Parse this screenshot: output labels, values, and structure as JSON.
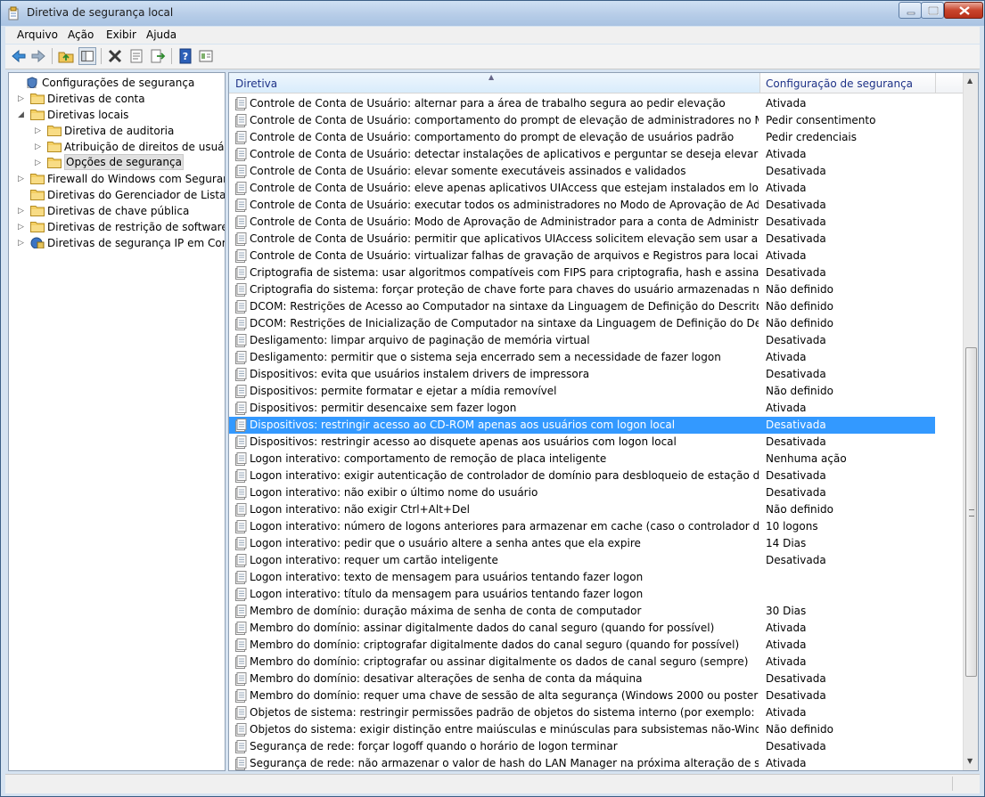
{
  "window": {
    "title": "Diretiva de segurança local"
  },
  "menu": [
    "Arquivo",
    "Ação",
    "Exibir",
    "Ajuda"
  ],
  "toolbar": [
    "back-icon",
    "forward-icon",
    "up-folder-icon",
    "show-hide-tree-icon",
    "delete-icon",
    "properties-icon",
    "export-list-icon",
    "help-icon",
    "view-icon"
  ],
  "tree": [
    {
      "label": "Configurações de segurança",
      "level": 0,
      "expander": "",
      "icon": "shield-icon",
      "selected": false
    },
    {
      "label": "Diretivas de conta",
      "level": 1,
      "expander": "▷",
      "icon": "folder-icon",
      "selected": false
    },
    {
      "label": "Diretivas locais",
      "level": 1,
      "expander": "◢",
      "icon": "folder-icon",
      "selected": false
    },
    {
      "label": "Diretiva de auditoria",
      "level": 2,
      "expander": "▷",
      "icon": "folder-icon",
      "selected": false
    },
    {
      "label": "Atribuição de direitos de usuário",
      "level": 2,
      "expander": "▷",
      "icon": "folder-icon",
      "selected": false
    },
    {
      "label": "Opções de segurança",
      "level": 2,
      "expander": "▷",
      "icon": "folder-icon",
      "selected": true
    },
    {
      "label": "Firewall do Windows com Segurança",
      "level": 1,
      "expander": "▷",
      "icon": "folder-icon",
      "selected": false
    },
    {
      "label": "Diretivas do Gerenciador de Listas de",
      "level": 1,
      "expander": "",
      "icon": "folder-icon",
      "selected": false
    },
    {
      "label": "Diretivas de chave pública",
      "level": 1,
      "expander": "▷",
      "icon": "folder-icon",
      "selected": false
    },
    {
      "label": "Diretivas de restrição de software",
      "level": 1,
      "expander": "▷",
      "icon": "folder-icon",
      "selected": false
    },
    {
      "label": "Diretivas de segurança IP em Comput",
      "level": 1,
      "expander": "▷",
      "icon": "network-policy-icon",
      "selected": false
    }
  ],
  "list": {
    "columns": [
      "Diretiva",
      "Configuração de segurança"
    ],
    "selected_index": 19,
    "rows": [
      {
        "policy": "Controle de Conta de Usuário: alternar para a área de trabalho segura ao pedir elevação",
        "setting": "Ativada"
      },
      {
        "policy": "Controle de Conta de Usuário: comportamento do prompt de elevação de administradores no Modo de A...",
        "setting": "Pedir consentimento"
      },
      {
        "policy": "Controle de Conta de Usuário: comportamento do prompt de elevação de usuários padrão",
        "setting": "Pedir credenciais"
      },
      {
        "policy": "Controle de Conta de Usuário: detectar instalações de aplicativos e perguntar se deseja elevar",
        "setting": "Ativada"
      },
      {
        "policy": "Controle de Conta de Usuário: elevar somente executáveis assinados e validados",
        "setting": "Desativada"
      },
      {
        "policy": "Controle de Conta de Usuário: eleve apenas aplicativos UIAccess que estejam instalados em locais seguros",
        "setting": "Ativada"
      },
      {
        "policy": "Controle de Conta de Usuário: executar todos os administradores no Modo de Aprovação de Administrador",
        "setting": "Desativada"
      },
      {
        "policy": "Controle de Conta de Usuário: Modo de Aprovação de Administrador para a conta de Administrador Interno",
        "setting": "Desativada"
      },
      {
        "policy": "Controle de Conta de Usuário: permitir que aplicativos UIAccess solicitem elevação sem usar a área de trab...",
        "setting": "Desativada"
      },
      {
        "policy": "Controle de Conta de Usuário: virtualizar falhas de gravação de arquivos e Registros para locais por usuário",
        "setting": "Ativada"
      },
      {
        "policy": "Criptografia de sistema: usar algoritmos compatíveis com FIPS para criptografia, hash e assinatura",
        "setting": "Desativada"
      },
      {
        "policy": "Criptografia do sistema: forçar proteção de chave forte para chaves do usuário armazenadas no computador",
        "setting": "Não definido"
      },
      {
        "policy": "DCOM: Restrições de Acesso ao Computador na sintaxe da Linguagem de Definição do Descritor de Segur...",
        "setting": "Não definido"
      },
      {
        "policy": "DCOM: Restrições de Inicialização de Computador na sintaxe da Linguagem de Definição do Descritor de S...",
        "setting": "Não definido"
      },
      {
        "policy": "Desligamento: limpar arquivo de paginação de memória virtual",
        "setting": "Desativada"
      },
      {
        "policy": "Desligamento: permitir que o sistema seja encerrado sem a necessidade de fazer logon",
        "setting": "Ativada"
      },
      {
        "policy": "Dispositivos: evita que usuários instalem drivers de impressora",
        "setting": "Desativada"
      },
      {
        "policy": "Dispositivos: permite formatar e ejetar a mídia removível",
        "setting": "Não definido"
      },
      {
        "policy": "Dispositivos: permitir desencaixe sem fazer logon",
        "setting": "Ativada"
      },
      {
        "policy": "Dispositivos: restringir acesso ao CD-ROM apenas aos usuários com logon local",
        "setting": "Desativada"
      },
      {
        "policy": "Dispositivos: restringir acesso ao disquete apenas aos usuários com logon local",
        "setting": "Desativada"
      },
      {
        "policy": "Logon interativo: comportamento de remoção de placa inteligente",
        "setting": "Nenhuma ação"
      },
      {
        "policy": "Logon interativo: exigir autenticação de controlador de domínio para desbloqueio de estação de trabalho",
        "setting": "Desativada"
      },
      {
        "policy": "Logon interativo: não exibir o último nome do usuário",
        "setting": "Desativada"
      },
      {
        "policy": "Logon interativo: não exigir Ctrl+Alt+Del",
        "setting": "Não definido"
      },
      {
        "policy": "Logon interativo: número de logons anteriores para armazenar em cache (caso o controlador de domínio ...",
        "setting": "10 logons"
      },
      {
        "policy": "Logon interativo: pedir que o usuário altere a senha antes que ela expire",
        "setting": "14 Dias"
      },
      {
        "policy": "Logon interativo: requer um cartão inteligente",
        "setting": "Desativada"
      },
      {
        "policy": "Logon interativo: texto de mensagem para usuários tentando fazer logon",
        "setting": ""
      },
      {
        "policy": "Logon interativo: título da mensagem para usuários tentando fazer logon",
        "setting": ""
      },
      {
        "policy": "Membro de domínio: duração máxima de senha de conta de computador",
        "setting": "30 Dias"
      },
      {
        "policy": "Membro do domínio: assinar digitalmente dados do canal seguro (quando for possível)",
        "setting": "Ativada"
      },
      {
        "policy": "Membro do domínio: criptografar digitalmente dados do canal seguro (quando for possível)",
        "setting": "Ativada"
      },
      {
        "policy": "Membro do domínio: criptografar ou assinar digitalmente os dados de canal seguro (sempre)",
        "setting": "Ativada"
      },
      {
        "policy": "Membro do domínio: desativar alterações de senha de conta da máquina",
        "setting": "Desativada"
      },
      {
        "policy": "Membro do domínio: requer uma chave de sessão de alta segurança (Windows 2000 ou posterior)",
        "setting": "Desativada"
      },
      {
        "policy": "Objetos de sistema: restringir permissões padrão de objetos do sistema interno (por exemplo: Ligações sim...",
        "setting": "Ativada"
      },
      {
        "policy": "Objetos do sistema: exigir distinção entre maiúsculas e minúsculas para subsistemas não-Windows",
        "setting": "Não definido"
      },
      {
        "policy": "Segurança de rede: forçar logoff quando o horário de logon terminar",
        "setting": "Desativada"
      },
      {
        "policy": "Segurança de rede: não armazenar o valor de hash do LAN Manager na próxima alteração de senha",
        "setting": "Ativada"
      }
    ]
  },
  "colors": {
    "selection": "#3399ff",
    "header_text": "#1e3287",
    "chrome": "#d6e3f1"
  }
}
